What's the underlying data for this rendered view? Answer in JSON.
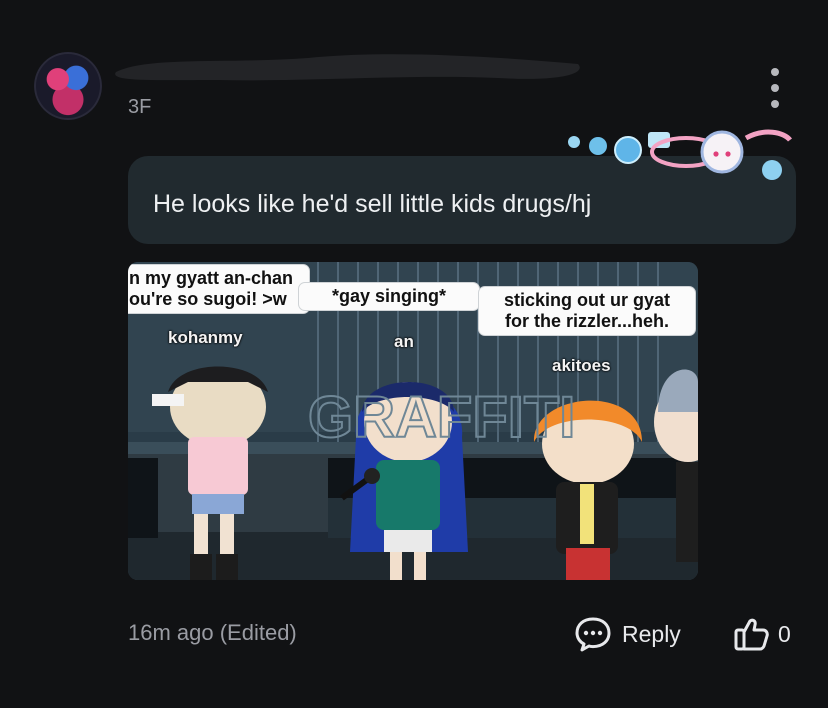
{
  "comment": {
    "floor": "3F",
    "body": "He looks like he'd sell little kids drugs/hj",
    "time": "16m ago (Edited)",
    "reply_label": "Reply",
    "like_count": "0"
  },
  "image": {
    "bubbles": {
      "left": "n my gyatt an-chan\nou're so sugoi! >w",
      "middle": "*gay singing*",
      "right": "sticking out ur gyat\nfor the rizzler...heh."
    },
    "names": {
      "left": "kohanmy",
      "middle": "an",
      "right": "akitoes"
    },
    "wall_text": "GRAFFITI"
  },
  "icons": {
    "more": "more-vertical-icon",
    "reply": "chat-bubble-icon",
    "like": "thumbs-up-icon"
  },
  "colors": {
    "background": "#111214",
    "bubble": "#212a2f",
    "muted_text": "#9a9ca3"
  }
}
